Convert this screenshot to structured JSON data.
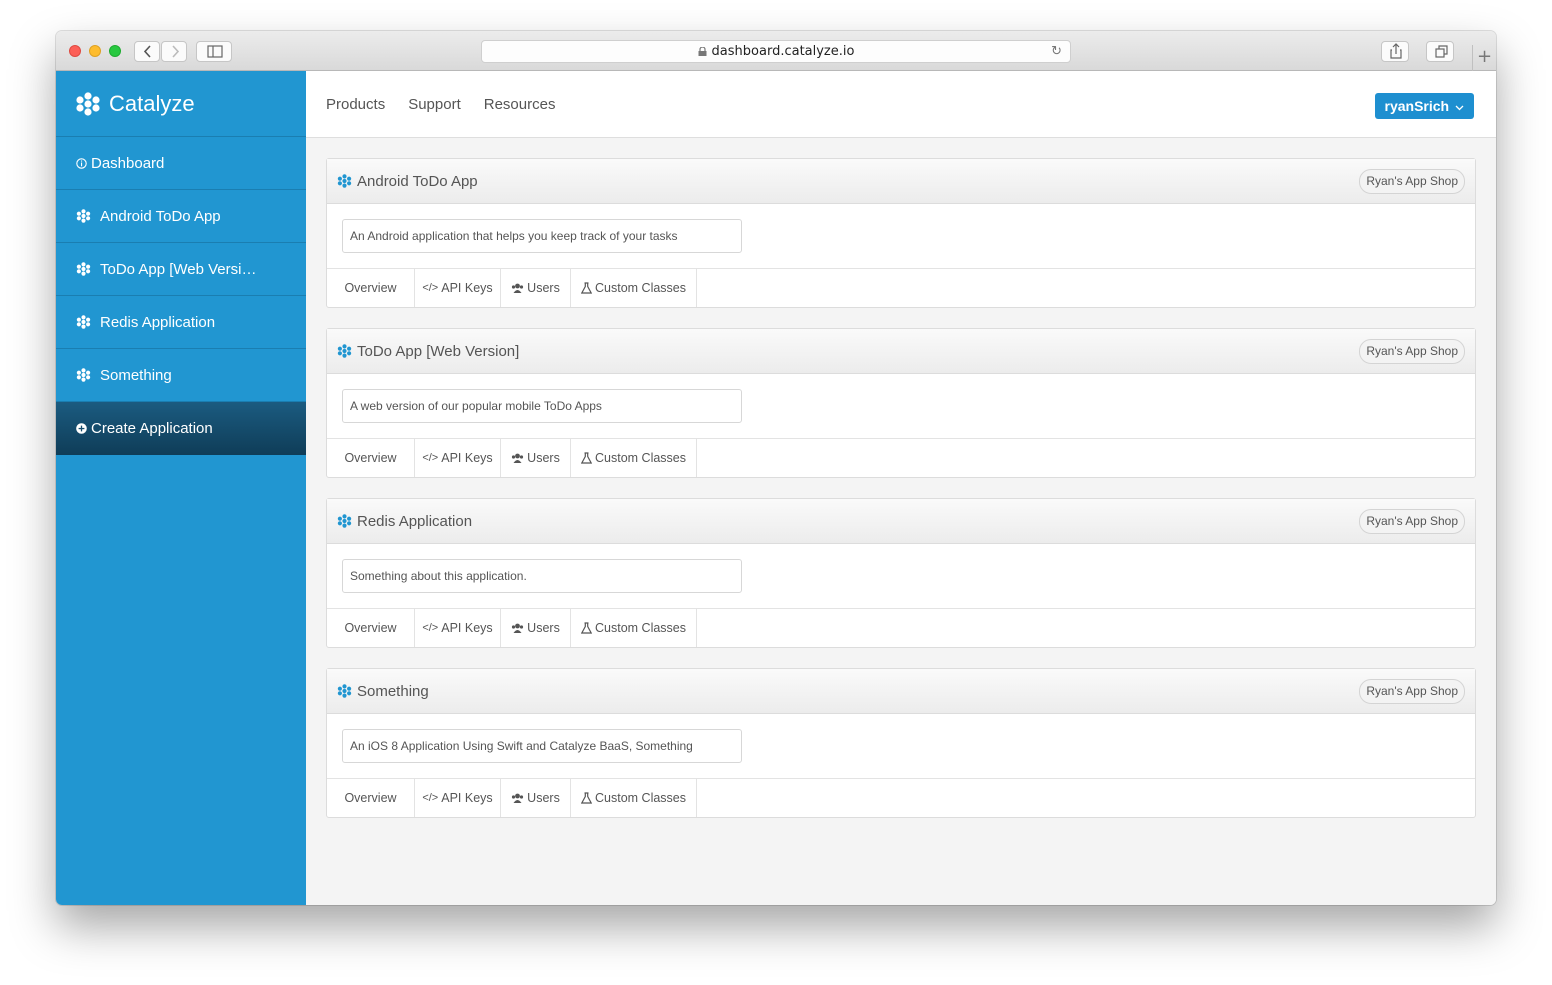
{
  "browser": {
    "url": "dashboard.catalyze.io",
    "new_tab": "+"
  },
  "brand": {
    "name": "Catalyze",
    "color": "#2196d1"
  },
  "sidebar": {
    "items": [
      {
        "label": "Dashboard",
        "icon": "info-circle-icon"
      },
      {
        "label": "Android ToDo App",
        "icon": "app-flower-icon"
      },
      {
        "label": "ToDo App [Web Versi…",
        "icon": "app-flower-icon"
      },
      {
        "label": "Redis Application",
        "icon": "app-flower-icon"
      },
      {
        "label": "Something",
        "icon": "app-flower-icon"
      }
    ],
    "create": {
      "label": "Create Application",
      "icon": "plus-circle-icon"
    }
  },
  "topnav": {
    "links": [
      "Products",
      "Support",
      "Resources"
    ],
    "user": "ryanSrich"
  },
  "apps": [
    {
      "title": "Android ToDo App",
      "org": "Ryan's App Shop",
      "description": "An Android application that helps you keep track of your tasks",
      "tabs": [
        "Overview",
        "API Keys",
        "Users",
        "Custom Classes"
      ]
    },
    {
      "title": "ToDo App [Web Version]",
      "org": "Ryan's App Shop",
      "description": "A web version of our popular mobile ToDo Apps",
      "tabs": [
        "Overview",
        "API Keys",
        "Users",
        "Custom Classes"
      ]
    },
    {
      "title": "Redis Application",
      "org": "Ryan's App Shop",
      "description": "Something about this application.",
      "tabs": [
        "Overview",
        "API Keys",
        "Users",
        "Custom Classes"
      ]
    },
    {
      "title": "Something",
      "org": "Ryan's App Shop",
      "description": "An iOS 8 Application Using Swift and Catalyze BaaS, Something",
      "tabs": [
        "Overview",
        "API Keys",
        "Users",
        "Custom Classes"
      ]
    }
  ]
}
